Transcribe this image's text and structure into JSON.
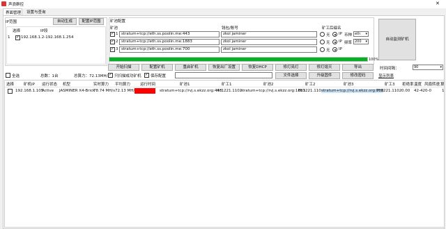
{
  "window": {
    "title": "声浪群控",
    "close_glyph": "✕"
  },
  "tabs": [
    {
      "label": "界面管理"
    },
    {
      "label": "设置与查询"
    }
  ],
  "ip_range": {
    "group_title": "IP范围",
    "auto_generate_button": "自动生成",
    "config_ip_button": "配置IP范围",
    "col_select": "选择",
    "col_range": "IP段",
    "rows": [
      {
        "index": "1",
        "checked": true,
        "range": "192.168.1.2-192.168.1.254"
      }
    ]
  },
  "miner_config": {
    "group_title": "矿池配置",
    "col_pool": "矿池",
    "col_worker": "钱包/账号",
    "col_mode": "矿工后缀名",
    "rows": [
      {
        "index": "1",
        "checked": true,
        "pool": "stratum+tcp://eth.ss.poolin.me:443",
        "worker": "zkol jaminer",
        "radio_none": "无",
        "radio_ip": "IP",
        "extra_label": "币种",
        "extra_value": "eth",
        "selected": "ip"
      },
      {
        "index": "2",
        "checked": true,
        "pool": "stratum+tcp://eth.ss.poolin.me:1883",
        "worker": "zkol jaminer",
        "radio_none": "无",
        "radio_ip": "IP",
        "extra_label": "频率",
        "extra_value": "200",
        "selected": "ip"
      },
      {
        "index": "3",
        "checked": true,
        "pool": "stratum+tcp://eth.ss.poolin.me:700",
        "worker": "zkol jaminer",
        "radio_none": "无",
        "radio_ip": "IP",
        "extra_label": "",
        "extra_value": "",
        "selected": "ip"
      }
    ],
    "auto_monitor_button": "自动监测矿机"
  },
  "progress": {
    "label": "100%",
    "value_percent": 100
  },
  "actions_row1": [
    "开始扫描",
    "配置矿机",
    "重启矿机",
    "恢复出厂设置",
    "恢复DHCP",
    "修灯亮灯",
    "修灯熄灭",
    "导出"
  ],
  "time_interval": {
    "label": "时间间隔：",
    "value": "90"
  },
  "options_row2": {
    "select_all": "全选",
    "total_label": "总数：1台",
    "total_hashrate": "总算力：72.13MH/s",
    "only_success_label": "只扫描成功矿机",
    "save_config_label": "保存配置",
    "file_select_button": "文件选择",
    "upgrade_button": "升级固件",
    "change_password_button": "修改密码",
    "show_list_link": "显示列表"
  },
  "table": {
    "headers": [
      "选择",
      "矿机IP",
      "运行状态",
      "机型",
      "实时算力",
      "平均算力",
      "运行时间",
      "矿池1",
      "矿工1",
      "矿池2",
      "矿工2",
      "矿池3",
      "矿工3",
      "拒绝率",
      "温度",
      "风扇转速",
      "算"
    ],
    "rows": [
      {
        "checked": false,
        "ip": "192.168.1.105",
        "status": "Active",
        "model": "JASMINER X4-Brick",
        "realtime": "78.74 MH/s",
        "average": "72.13 MH/s",
        "runtime": "0d 0h 0m",
        "pool1": "stratum+tcp://rvj.s.ekzz.org:443",
        "worker1": "lfc1221.1102",
        "pool2": "stratum+tcp://rvj.s.ekzz.org:1883",
        "worker2": "lfc1221.1102",
        "pool3": "stratum+tcp://rvj.s.ekzz.org:700",
        "worker3": "lfc1221.1102",
        "reject": "0.00",
        "temp": "42-42",
        "fan": "0-0",
        "last": "1"
      }
    ]
  },
  "colors": {
    "progress": "#06b025",
    "highlight": "#ff0000",
    "selection_bg": "#cce4f7"
  }
}
